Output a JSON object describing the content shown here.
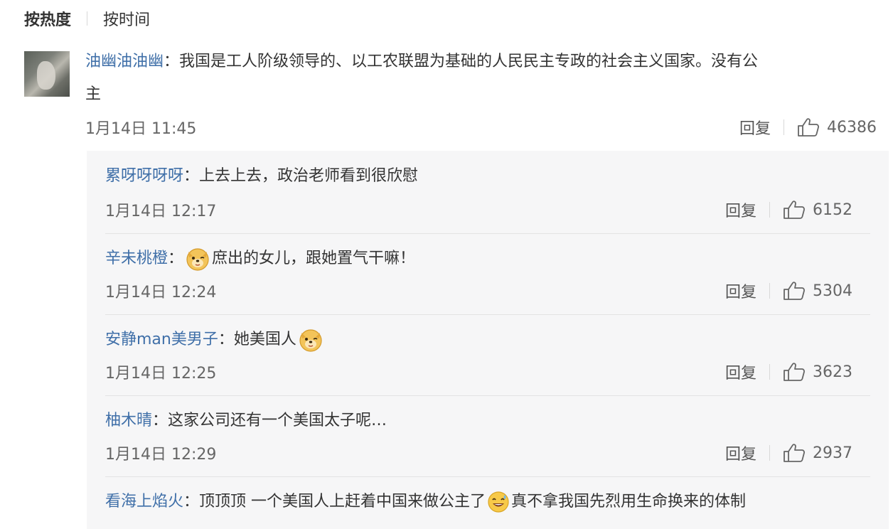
{
  "sort": {
    "hot_label": "按热度",
    "time_label": "按时间"
  },
  "main_comment": {
    "username": "油幽油油幽",
    "separator": "：",
    "text_line1": "我国是工人阶级领导的、以工农联盟为基础的人民民主专政的社会主义国家。没有公",
    "text_line2": "主",
    "time": "1月14日 11:45",
    "reply_label": "回复",
    "likes": "46386"
  },
  "replies": [
    {
      "username": "累呀呀呀呀",
      "separator": "：",
      "text": "上去上去，政治老师看到很欣慰",
      "time": "1月14日 12:17",
      "reply_label": "回复",
      "likes": "6152"
    },
    {
      "username": "辛未桃橙",
      "separator": "：",
      "emoji_before": "doge-emoji",
      "text": "庶出的女儿，跟她置气干嘛！",
      "time": "1月14日 12:24",
      "reply_label": "回复",
      "likes": "5304"
    },
    {
      "username": "安静man美男子",
      "separator": "：",
      "text": "她美国人",
      "emoji_after": "doge-emoji",
      "time": "1月14日 12:25",
      "reply_label": "回复",
      "likes": "3623"
    },
    {
      "username": "柚木晴",
      "separator": "：",
      "text": "这家公司还有一个美国太子呢…",
      "time": "1月14日 12:29",
      "reply_label": "回复",
      "likes": "2937"
    },
    {
      "username": "看海上焰火",
      "separator": "：",
      "text_before": "顶顶顶 一个美国人上赶着中国来做公主了",
      "emoji_mid": "laugh-sweat-emoji",
      "text_after": "真不拿我国先烈用生命换来的体制"
    }
  ],
  "colors": {
    "username": "#3f6fa8",
    "text": "#333333",
    "meta": "#666666",
    "panel_bg": "#f6f6f7"
  }
}
